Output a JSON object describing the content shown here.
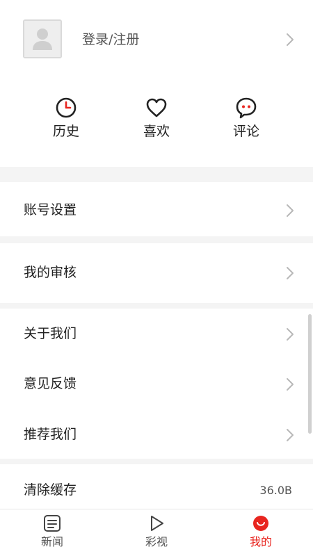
{
  "profile": {
    "login_label": "登录/注册"
  },
  "quick_actions": [
    {
      "label": "历史",
      "icon": "clock-icon"
    },
    {
      "label": "喜欢",
      "icon": "heart-icon"
    },
    {
      "label": "评论",
      "icon": "comment-icon"
    }
  ],
  "menu": {
    "account_settings": "账号设置",
    "my_review": "我的审核",
    "about_us": "关于我们",
    "feedback": "意见反馈",
    "recommend_us": "推荐我们",
    "clear_cache": "清除缓存",
    "cache_size": "36.0B"
  },
  "tabs": [
    {
      "label": "新闻",
      "icon": "news-icon",
      "active": false
    },
    {
      "label": "彩视",
      "icon": "play-icon",
      "active": false
    },
    {
      "label": "我的",
      "icon": "me-icon",
      "active": true
    }
  ],
  "colors": {
    "accent": "#e8251f",
    "icon_dark": "#222222",
    "chevron": "#b8b8b8",
    "background": "#f4f4f4"
  }
}
